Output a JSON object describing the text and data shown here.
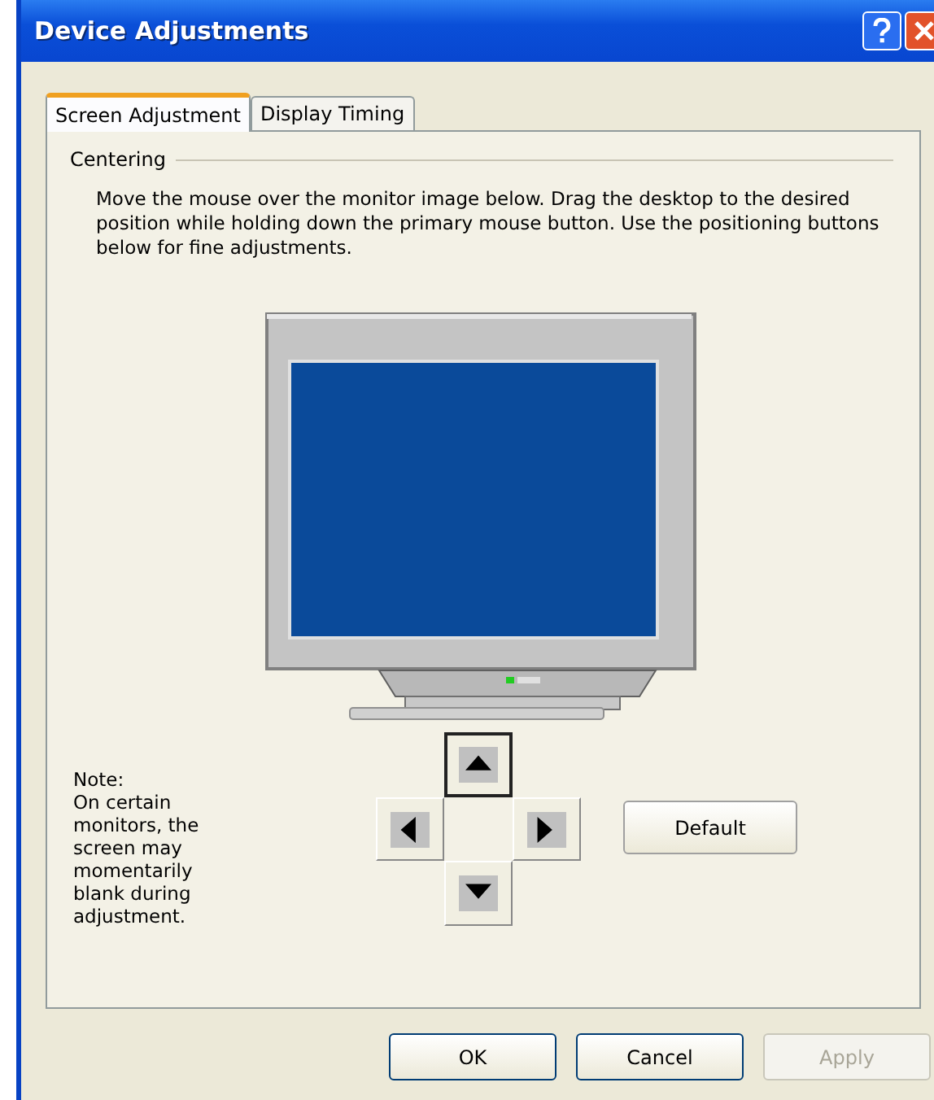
{
  "window": {
    "title": "Device Adjustments"
  },
  "tabs": [
    {
      "label": "Screen Adjustment",
      "selected": true
    },
    {
      "label": "Display Timing",
      "selected": false
    }
  ],
  "group": {
    "title": "Centering",
    "instructions": "Move the mouse over the monitor image below. Drag the desktop to the desired position while holding down the primary mouse button. Use the positioning buttons below for fine adjustments."
  },
  "note": {
    "heading": "Note:",
    "text": "On certain monitors, the screen may momentarily blank during adjustment."
  },
  "position_buttons": [
    {
      "kind": "up",
      "selected": true
    },
    {
      "kind": "left",
      "selected": false
    },
    {
      "kind": "right",
      "selected": false
    },
    {
      "kind": "down",
      "selected": false
    }
  ],
  "default_button": "Default",
  "buttons": [
    {
      "label": "OK",
      "disabled": false
    },
    {
      "label": "Cancel",
      "disabled": false
    },
    {
      "label": "Apply",
      "disabled": true
    }
  ]
}
